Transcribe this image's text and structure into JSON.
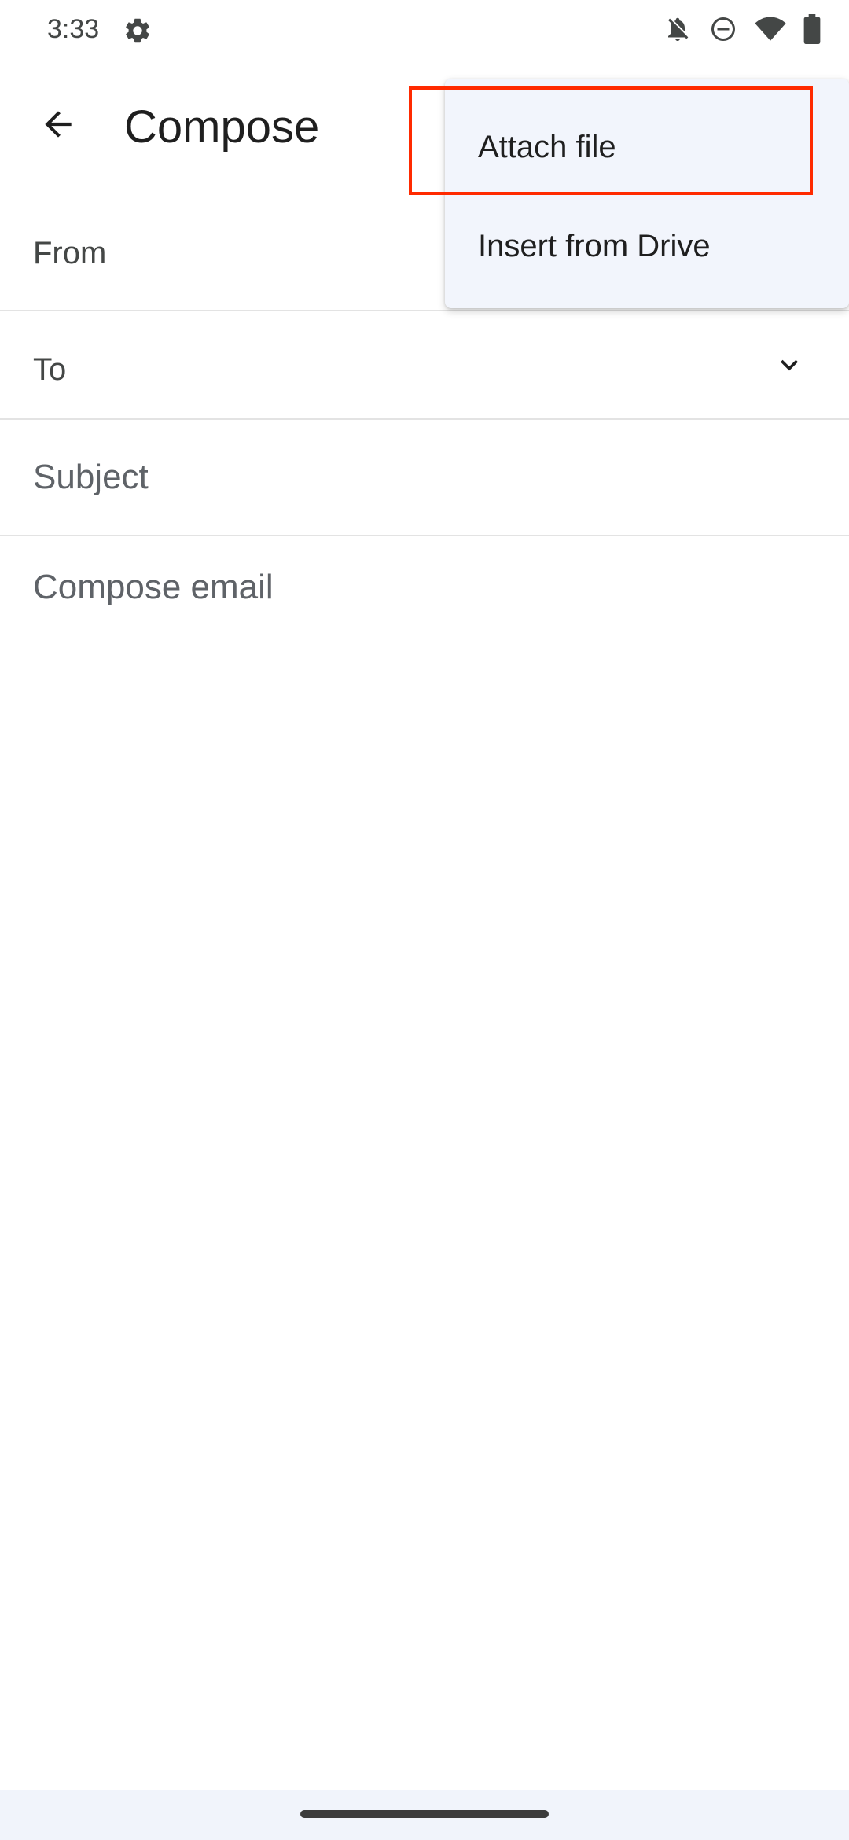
{
  "status_bar": {
    "time": "3:33",
    "icons": [
      "gear-icon",
      "notifications-off-icon",
      "do-not-disturb-icon",
      "wifi-icon",
      "battery-icon"
    ]
  },
  "app_bar": {
    "title": "Compose",
    "back_icon": "arrow-back-icon"
  },
  "fields": {
    "from_label": "From",
    "to_label": "To",
    "to_chevron_icon": "chevron-down-icon",
    "subject_placeholder": "Subject",
    "body_placeholder": "Compose email"
  },
  "popup_menu": {
    "items": [
      {
        "label": "Attach file"
      },
      {
        "label": "Insert from Drive"
      }
    ],
    "highlighted_item": "Attach file",
    "highlight_color": "#ff2a00"
  },
  "colors": {
    "menu_background": "#f2f5fc",
    "nav_bar_background": "#f1f4fb"
  }
}
